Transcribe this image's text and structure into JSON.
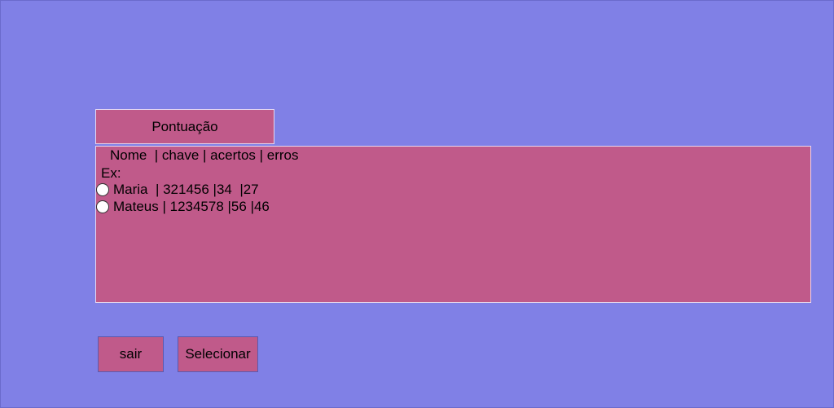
{
  "title": "Pontuação",
  "panel": {
    "header": "Nome  | chave | acertos | erros",
    "example_label": "Ex:",
    "rows": [
      {
        "text": "Maria  | 321456 |34  |27"
      },
      {
        "text": "Mateus | 1234578 |56 |46"
      }
    ]
  },
  "buttons": {
    "exit_label": "sair",
    "select_label": "Selecionar"
  },
  "colors": {
    "background": "#8080e6",
    "panel": "#c05a8a"
  }
}
